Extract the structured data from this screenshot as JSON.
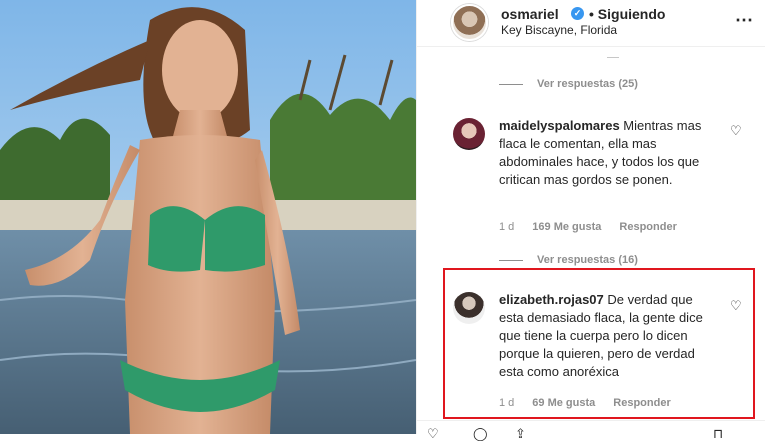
{
  "header": {
    "username": "osmariel",
    "verified": "✓",
    "follow_status": "• Siguiendo",
    "location": "Key Biscayne, Florida",
    "more_icon": "⋯"
  },
  "comments": {
    "view_replies_1": "Ver respuestas (25)",
    "comment_1": {
      "username": "maidelyspalomares",
      "text": " Mientras mas flaca le comentan, ella mas abdominales hace, y todos los que critican mas gordos se ponen.",
      "time": "1 d",
      "likes": "169 Me gusta",
      "reply": "Responder"
    },
    "view_replies_2": "Ver respuestas (16)",
    "comment_2": {
      "username": "elizabeth.rojas07",
      "text": " De verdad que esta demasiado flaca, la gente dice que tiene la cuerpa pero lo dicen porque la quieren, pero de verdad esta como anoréxica",
      "time": "1 d",
      "likes": "69 Me gusta",
      "reply": "Responder"
    },
    "heart_icon": "♡"
  },
  "actions": {
    "like_icon": "♡",
    "comment_icon": "◯",
    "share_icon": "⇪",
    "save_icon": "⊓"
  },
  "colors": {
    "highlight": "#e0161e",
    "verified": "#3897f0",
    "muted": "#8e8e8e"
  }
}
